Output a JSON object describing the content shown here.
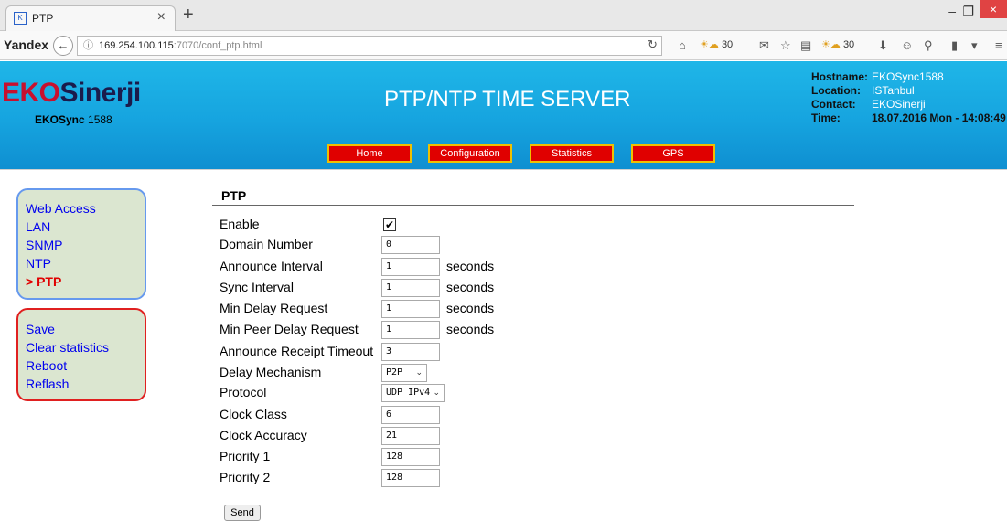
{
  "browser": {
    "tab_title": "PTP",
    "tab_favicon": "page-favicon",
    "brand": "Yandex",
    "url_host": "169.254.100.115",
    "url_path": ":7070/conf_ptp.html",
    "weather_temp_1": "30",
    "weather_temp_2": "30"
  },
  "header": {
    "logo_part1": "EKO",
    "logo_part2": "Sinerji",
    "model_bold": "EKOSync",
    "model_num": "1588",
    "title": "PTP/NTP TIME SERVER",
    "info": {
      "hostname_label": "Hostname:",
      "hostname": "EKOSync1588",
      "location_label": "Location:",
      "location": "ISTanbul",
      "contact_label": "Contact:",
      "contact": "EKOSinerji",
      "time_label": "Time:",
      "time": "18.07.2016 Mon - 14:08:49"
    },
    "nav": [
      "Home",
      "Configuration",
      "Statistics",
      "GPS"
    ]
  },
  "sidebar": {
    "config_links": [
      "Web Access",
      "LAN",
      "SNMP",
      "NTP",
      "> PTP"
    ],
    "action_links": [
      "Save",
      "Clear statistics",
      "Reboot",
      "Reflash"
    ]
  },
  "form": {
    "section_title": "PTP",
    "enable_label": "Enable",
    "enable_checked": true,
    "domain_label": "Domain Number",
    "domain_value": "0",
    "announce_label": "Announce Interval",
    "announce_value": "1",
    "sync_label": "Sync Interval",
    "sync_value": "1",
    "mindelay_label": "Min Delay Request",
    "mindelay_value": "1",
    "minpeer_label": "Min Peer Delay Request",
    "minpeer_value": "1",
    "receipt_label": "Announce Receipt Timeout",
    "receipt_value": "3",
    "delaymech_label": "Delay Mechanism",
    "delaymech_value": "P2P",
    "protocol_label": "Protocol",
    "protocol_value": "UDP IPv4",
    "clockclass_label": "Clock Class",
    "clockclass_value": "6",
    "clockacc_label": "Clock Accuracy",
    "clockacc_value": "21",
    "prio1_label": "Priority 1",
    "prio1_value": "128",
    "prio2_label": "Priority 2",
    "prio2_value": "128",
    "unit": "seconds",
    "send_label": "Send"
  },
  "colors": {
    "header_blue": "#16a4df",
    "nav_red": "#e00000",
    "nav_border": "#f0c000",
    "logo_red": "#c8102e",
    "link_blue": "#0000ee"
  }
}
